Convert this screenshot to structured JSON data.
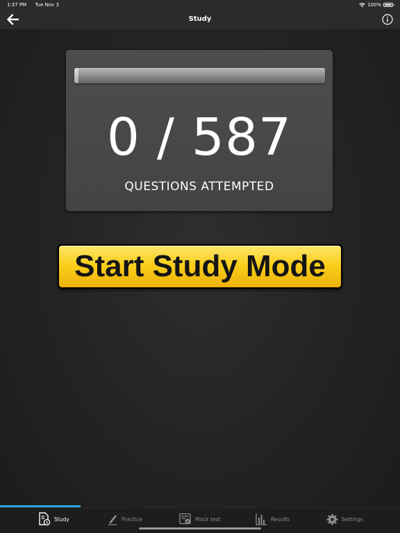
{
  "status_bar": {
    "time": "1:37 PM",
    "date": "Tue Nov 3",
    "battery": "100%"
  },
  "nav": {
    "title": "Study"
  },
  "progress": {
    "attempted": "0",
    "separator": "/",
    "total": "587",
    "label": "QUESTIONS ATTEMPTED",
    "fraction": 0.0
  },
  "start_button": {
    "label": "Start Study Mode"
  },
  "tabs": [
    {
      "label": "Study",
      "icon": "study-document-icon",
      "active": true
    },
    {
      "label": "Practice",
      "icon": "pencil-icon",
      "active": false
    },
    {
      "label": "Mock test",
      "icon": "mock-test-icon",
      "active": false
    },
    {
      "label": "Results",
      "icon": "bar-chart-icon",
      "active": false
    },
    {
      "label": "Settings",
      "icon": "gear-icon",
      "active": false
    }
  ],
  "colors": {
    "accent": "#29a8e0",
    "button_yellow": "#f9cf1c",
    "background": "#232323"
  }
}
